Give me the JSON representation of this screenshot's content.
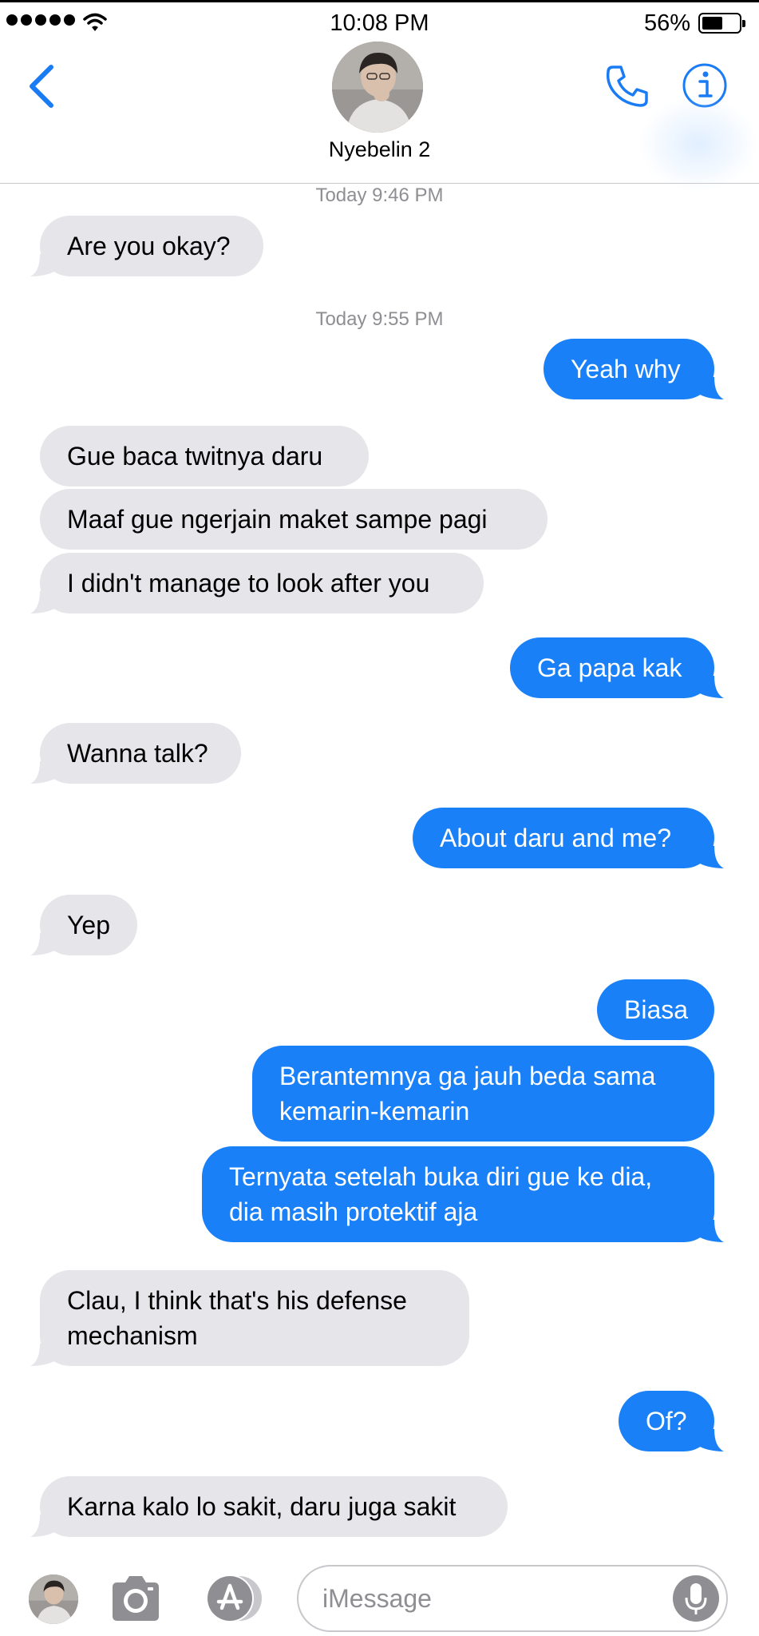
{
  "status_bar": {
    "time": "10:08 PM",
    "battery_percent": "56%",
    "battery_level": 0.56
  },
  "header": {
    "contact_name": "Nyebelin 2",
    "back_icon": "chevron-left-icon",
    "call_icon": "phone-icon",
    "info_icon": "info-icon"
  },
  "thread": {
    "timestamps": [
      "Today 9:46 PM",
      "Today 9:55 PM"
    ],
    "messages": [
      {
        "from": "contact",
        "text": "Are you okay?"
      },
      {
        "from": "me",
        "text": "Yeah why"
      },
      {
        "from": "contact",
        "text": "Gue baca twitnya daru"
      },
      {
        "from": "contact",
        "text": "Maaf gue ngerjain maket sampe pagi"
      },
      {
        "from": "contact",
        "text": "I didn't manage to look after you"
      },
      {
        "from": "me",
        "text": "Ga papa kak"
      },
      {
        "from": "contact",
        "text": "Wanna talk?"
      },
      {
        "from": "me",
        "text": "About daru and me?"
      },
      {
        "from": "contact",
        "text": "Yep"
      },
      {
        "from": "me",
        "text": "Biasa"
      },
      {
        "from": "me",
        "text": "Berantemnya ga jauh beda sama kemarin-kemarin"
      },
      {
        "from": "me",
        "text": "Ternyata setelah buka diri gue ke dia, dia masih protektif aja"
      },
      {
        "from": "contact",
        "text": "Clau, I think that's his defense mechanism"
      },
      {
        "from": "me",
        "text": "Of?"
      },
      {
        "from": "contact",
        "text": "Karna kalo lo sakit, daru juga sakit"
      }
    ]
  },
  "compose": {
    "placeholder": "iMessage",
    "camera_icon": "camera-icon",
    "apps_icon": "app-store-icon",
    "mic_icon": "microphone-icon"
  },
  "colors": {
    "outgoing": "#1a80f8",
    "incoming": "#e5e5ea",
    "accent": "#1a7cf5",
    "timestamp": "#8e8e93"
  }
}
